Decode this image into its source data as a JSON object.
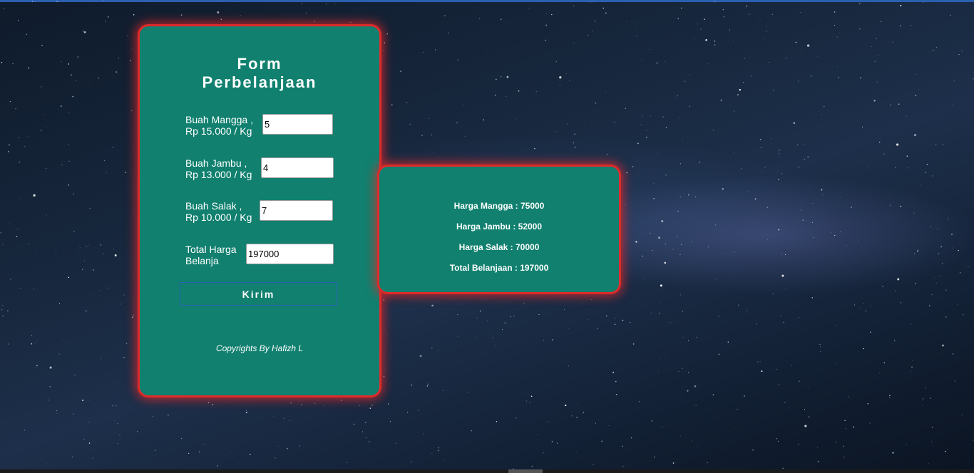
{
  "form": {
    "title_line1": "Form",
    "title_line2": "Perbelanjaan",
    "mangga": {
      "label_line1": "Buah Mangga ,",
      "label_line2": "Rp 15.000 / Kg",
      "value": "5"
    },
    "jambu": {
      "label_line1": "Buah Jambu ,",
      "label_line2": "Rp 13.000 / Kg",
      "value": "4"
    },
    "salak": {
      "label_line1": "Buah Salak ,",
      "label_line2": "Rp 10.000 / Kg",
      "value": "7"
    },
    "total": {
      "label_line1": "Total Harga",
      "label_line2": "Belanja",
      "value": "197000"
    },
    "submit_label": "Kirim",
    "copyright": "Copyrights By Hafizh L"
  },
  "result": {
    "mangga": "Harga Mangga : 75000",
    "jambu": "Harga Jambu : 52000",
    "salak": "Harga Salak : 70000",
    "total": "Total Belanjaan : 197000"
  },
  "colors": {
    "card": "#11806f",
    "glow": "#e02a2a",
    "button_border": "#2a5fb8"
  }
}
